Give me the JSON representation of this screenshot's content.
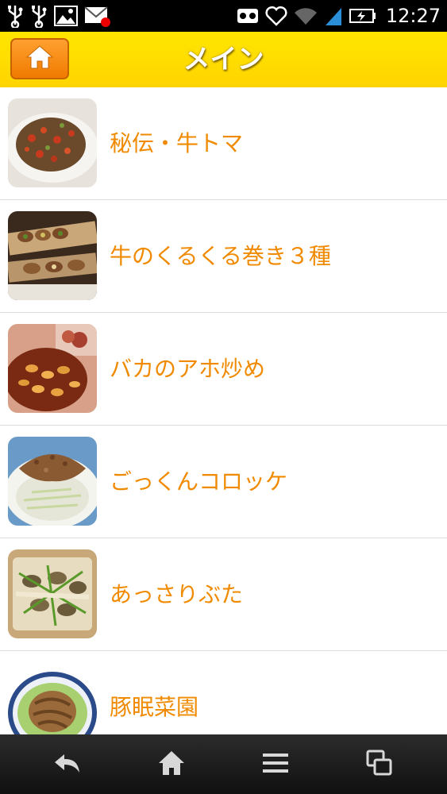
{
  "status_bar": {
    "time": "12:27",
    "left_icons": [
      "usb-icon",
      "usb-icon",
      "image-icon",
      "mail-icon"
    ],
    "right_icons": [
      "voicemail-icon",
      "heart-icon",
      "wifi-icon",
      "signal-icon",
      "battery-charging-icon"
    ]
  },
  "header": {
    "title": "メイン",
    "home_icon": "home-icon",
    "colors": {
      "bar": "#ffdd00",
      "home_button": "#f08000",
      "title": "#ffffff"
    }
  },
  "menu": {
    "items": [
      {
        "label": "秘伝・牛トマ",
        "thumb": "beef-tomato-dish"
      },
      {
        "label": "牛のくるくる巻き３種",
        "thumb": "beef-rolls-dish"
      },
      {
        "label": "バカのアホ炒め",
        "thumb": "garlic-stirfry-dish"
      },
      {
        "label": "ごっくんコロッケ",
        "thumb": "croquette-cabbage-dish"
      },
      {
        "label": "あっさりぶた",
        "thumb": "pork-clams-dish"
      },
      {
        "label": "豚眠菜園",
        "thumb": "pork-lettuce-dish"
      }
    ],
    "label_color": "#f08a00"
  },
  "nav_bar": {
    "buttons": [
      "back-icon",
      "home-icon",
      "menu-icon",
      "recent-apps-icon"
    ]
  }
}
